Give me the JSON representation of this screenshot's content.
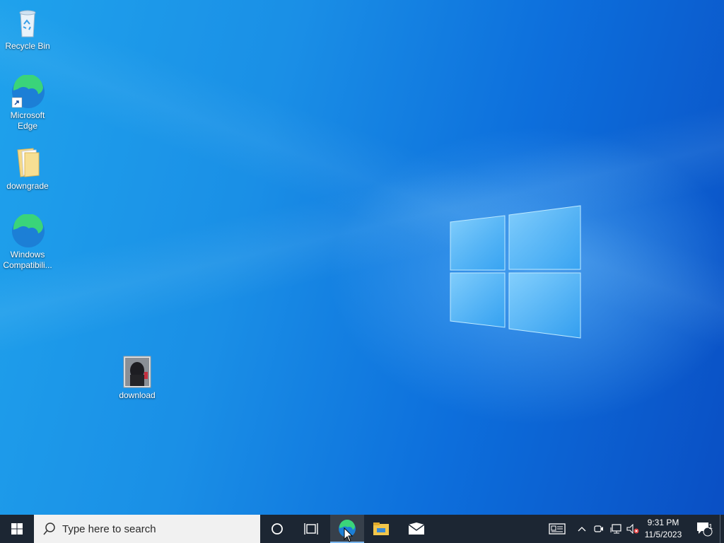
{
  "desktop": {
    "icons": [
      {
        "label": "Recycle Bin",
        "icon": "recycle-bin-icon"
      },
      {
        "label": "Microsoft Edge",
        "icon": "edge-icon",
        "shortcut": true
      },
      {
        "label": "downgrade",
        "icon": "folder-icon"
      },
      {
        "label": "Windows Compatibili...",
        "icon": "edge-icon"
      },
      {
        "label": "download",
        "icon": "image-thumbnail-icon"
      }
    ]
  },
  "taskbar": {
    "search_placeholder": "Type here to search",
    "pinned": [
      "cortana-icon",
      "task-view-icon",
      "edge-icon",
      "file-explorer-icon",
      "mail-icon"
    ],
    "active_app": "edge",
    "tray": {
      "icons": [
        "news-icon",
        "show-hidden-icons-chevron",
        "meet-now-icon",
        "network-icon",
        "volume-muted-icon"
      ],
      "time": "9:31 PM",
      "date": "11/5/2023",
      "notification_count": "1"
    }
  },
  "colors": {
    "desktop_accent": "#1a8fe6",
    "taskbar": "#1c2633",
    "search_box": "#f1f1f1"
  }
}
